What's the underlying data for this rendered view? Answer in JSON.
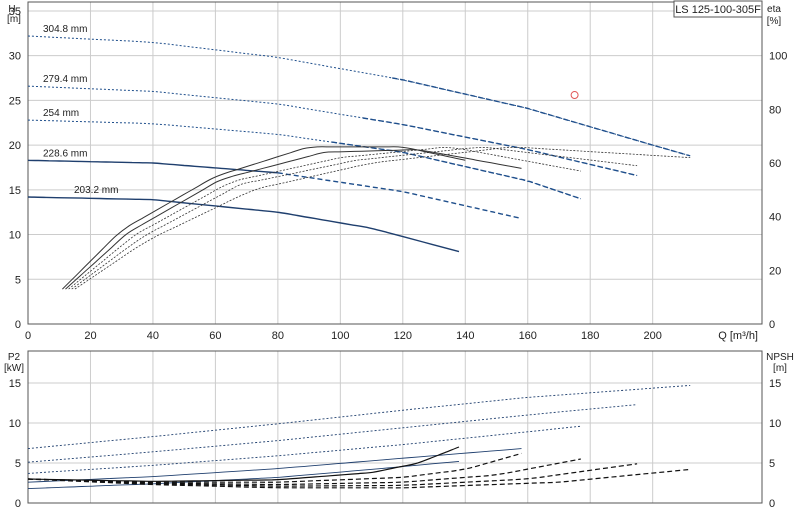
{
  "model_label": "LS 125-100-305F",
  "colors": {
    "grid": "#cccccc",
    "axis": "#555555",
    "head": "#1f3f6e",
    "dashed_head": "#1f4f8c",
    "eta": "#333333",
    "marker": "#e05555"
  },
  "chart_data": [
    {
      "type": "line",
      "id": "head",
      "ylabel": "H",
      "yunit": "[m]",
      "y2label": "eta",
      "y2unit": "[%]",
      "xunit": "Q [m³/h]",
      "xlim": [
        0,
        235
      ],
      "ylim": [
        0,
        36
      ],
      "y2lim": [
        0,
        120
      ],
      "xticks": [
        0,
        20,
        40,
        60,
        80,
        100,
        120,
        140,
        160,
        180,
        200
      ],
      "yticks": [
        0,
        5,
        10,
        15,
        20,
        25,
        30,
        35
      ],
      "y2ticks": [
        0,
        20,
        40,
        60,
        80,
        100
      ],
      "grid": true,
      "head_curves": [
        {
          "name": "304.8 mm",
          "q": [
            0,
            40,
            80,
            120,
            160,
            200,
            212
          ],
          "h": [
            32.2,
            31.5,
            29.8,
            27.3,
            24.1,
            20.0,
            18.8
          ],
          "solid_until": 0
        },
        {
          "name": "279.4 mm",
          "q": [
            0,
            40,
            80,
            120,
            160,
            195
          ],
          "h": [
            26.6,
            26.0,
            24.6,
            22.3,
            19.5,
            16.6
          ],
          "solid_until": 0
        },
        {
          "name": "254 mm",
          "q": [
            0,
            40,
            80,
            120,
            160,
            177
          ],
          "h": [
            22.8,
            22.4,
            21.2,
            19.2,
            16.0,
            14.0
          ],
          "solid_until": 0
        },
        {
          "name": "228.6 mm",
          "q": [
            0,
            40,
            80,
            120,
            158
          ],
          "h": [
            18.3,
            18.0,
            16.9,
            14.8,
            11.8
          ],
          "solid_until": 80
        },
        {
          "name": "203.2 mm",
          "q": [
            0,
            40,
            80,
            110,
            138
          ],
          "h": [
            14.2,
            13.9,
            12.5,
            10.7,
            8.1
          ],
          "solid_until": 138
        }
      ],
      "eta_curves": [
        {
          "q": [
            11,
            30,
            60,
            90,
            120,
            140
          ],
          "eta": [
            13,
            35,
            55,
            66,
            66,
            61
          ]
        },
        {
          "q": [
            12,
            32,
            62,
            95,
            125,
            158
          ],
          "eta": [
            13,
            34,
            54,
            64,
            65,
            58
          ]
        },
        {
          "q": [
            13,
            34,
            65,
            100,
            135,
            177
          ],
          "eta": [
            13,
            33,
            53,
            62,
            66,
            57
          ]
        },
        {
          "q": [
            14,
            36,
            68,
            105,
            145,
            195
          ],
          "eta": [
            13,
            32,
            52,
            61,
            66,
            59
          ]
        },
        {
          "q": [
            15,
            38,
            72,
            110,
            155,
            212
          ],
          "eta": [
            13,
            31,
            50,
            60,
            66,
            62
          ]
        }
      ],
      "marker": {
        "q": 175,
        "h": 25.6
      }
    },
    {
      "type": "line",
      "id": "power-npsh",
      "ylabel": "P2",
      "yunit": "[kW]",
      "y2label": "NPSH",
      "y2unit": "[m]",
      "xlim": [
        0,
        235
      ],
      "ylim": [
        0,
        19
      ],
      "y2lim": [
        0,
        19
      ],
      "yticks": [
        0,
        5,
        10,
        15
      ],
      "y2ticks": [
        0,
        5,
        10,
        15
      ],
      "grid": true,
      "power_curves": [
        {
          "q": [
            0,
            40,
            80,
            120,
            160,
            212
          ],
          "p": [
            6.8,
            8.3,
            9.9,
            11.6,
            13.2,
            14.7
          ]
        },
        {
          "q": [
            0,
            40,
            80,
            120,
            160,
            195
          ],
          "p": [
            5.1,
            6.4,
            7.8,
            9.4,
            11.0,
            12.3
          ]
        },
        {
          "q": [
            0,
            40,
            80,
            120,
            160,
            177
          ],
          "p": [
            3.7,
            4.7,
            5.9,
            7.3,
            8.9,
            9.6
          ]
        },
        {
          "q": [
            0,
            40,
            80,
            120,
            158
          ],
          "p": [
            2.6,
            3.3,
            4.3,
            5.6,
            6.8
          ]
        },
        {
          "q": [
            0,
            40,
            80,
            110,
            138
          ],
          "p": [
            1.8,
            2.4,
            3.2,
            4.2,
            5.2
          ]
        }
      ],
      "npsh_curves": [
        {
          "q": [
            0,
            40,
            80,
            110,
            125,
            138
          ],
          "n": [
            3.0,
            2.7,
            2.9,
            3.8,
            5.0,
            7.0
          ]
        },
        {
          "q": [
            0,
            40,
            80,
            120,
            140,
            158
          ],
          "n": [
            3.0,
            2.6,
            2.6,
            3.2,
            4.2,
            6.2
          ]
        },
        {
          "q": [
            0,
            40,
            80,
            120,
            150,
            177
          ],
          "n": [
            3.0,
            2.5,
            2.3,
            2.6,
            3.5,
            5.5
          ]
        },
        {
          "q": [
            0,
            40,
            80,
            120,
            160,
            195
          ],
          "n": [
            3.0,
            2.4,
            2.1,
            2.2,
            3.0,
            4.9
          ]
        },
        {
          "q": [
            0,
            40,
            80,
            120,
            170,
            212
          ],
          "n": [
            3.0,
            2.3,
            1.9,
            1.9,
            2.6,
            4.2
          ]
        }
      ]
    }
  ]
}
